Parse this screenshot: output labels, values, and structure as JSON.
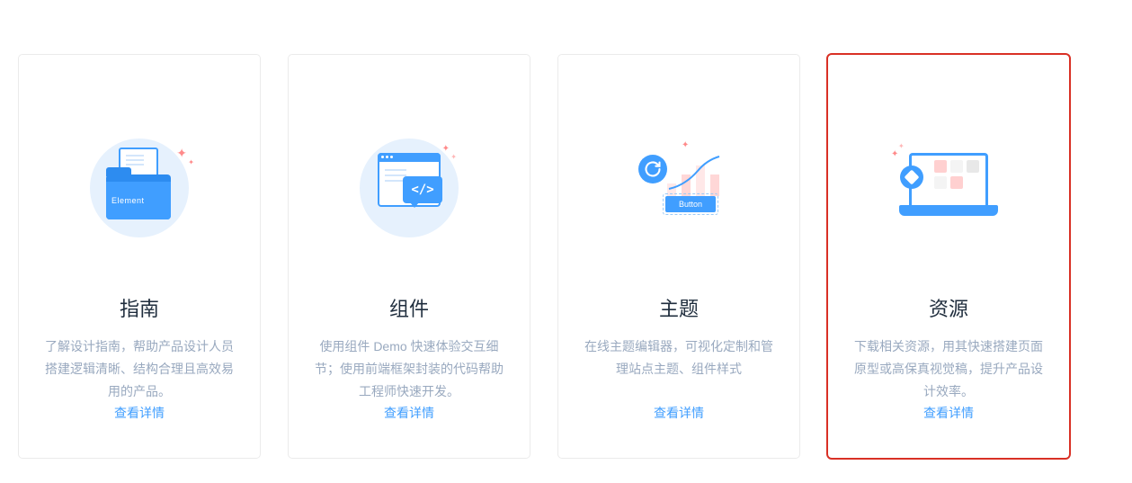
{
  "cards": [
    {
      "title": "指南",
      "description": "了解设计指南，帮助产品设计人员搭建逻辑清晰、结构合理且高效易用的产品。",
      "link_label": "查看详情",
      "icon_label": "Element"
    },
    {
      "title": "组件",
      "description": "使用组件 Demo 快速体验交互细节；使用前端框架封装的代码帮助工程师快速开发。",
      "link_label": "查看详情",
      "icon_label": "</>"
    },
    {
      "title": "主题",
      "description": "在线主题编辑器，可视化定制和管理站点主题、组件样式",
      "link_label": "查看详情",
      "icon_label": "Button"
    },
    {
      "title": "资源",
      "description": "下载相关资源，用其快速搭建页面原型或高保真视觉稿，提升产品设计效率。",
      "link_label": "查看详情"
    }
  ]
}
